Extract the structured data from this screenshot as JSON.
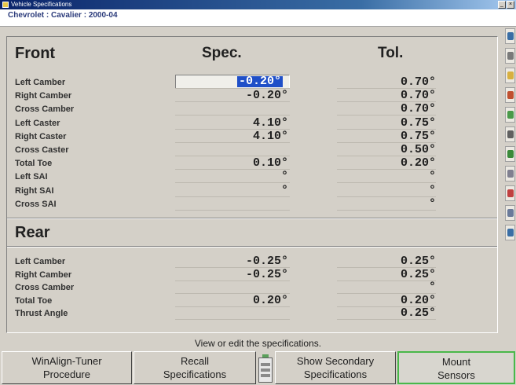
{
  "window": {
    "title": "Vehicle Specifications"
  },
  "vehicle": "Chevrolet : Cavalier : 2000-04",
  "headers": {
    "front": "Front",
    "spec": "Spec.",
    "tol": "Tol.",
    "rear": "Rear"
  },
  "front_rows": [
    {
      "label": "Left Camber",
      "spec": "-0.20°",
      "tol": "0.70°"
    },
    {
      "label": "Right Camber",
      "spec": "-0.20°",
      "tol": "0.70°"
    },
    {
      "label": "Cross Camber",
      "spec": "",
      "tol": "0.70°"
    },
    {
      "label": "Left Caster",
      "spec": "4.10°",
      "tol": "0.75°"
    },
    {
      "label": "Right Caster",
      "spec": "4.10°",
      "tol": "0.75°"
    },
    {
      "label": "Cross Caster",
      "spec": "",
      "tol": "0.50°"
    },
    {
      "label": "Total Toe",
      "spec": "0.10°",
      "tol": "0.20°"
    },
    {
      "label": "Left SAI",
      "spec": "°",
      "tol": "°"
    },
    {
      "label": "Right SAI",
      "spec": "°",
      "tol": "°"
    },
    {
      "label": "Cross SAI",
      "spec": "",
      "tol": "°"
    }
  ],
  "selected_spec": "-0.20",
  "selected_spec_unit": "°",
  "rear_rows": [
    {
      "label": "Left Camber",
      "spec": "-0.25°",
      "tol": "0.25°"
    },
    {
      "label": "Right Camber",
      "spec": "-0.25°",
      "tol": "0.25°"
    },
    {
      "label": "Cross Camber",
      "spec": "",
      "tol": "°"
    },
    {
      "label": "Total Toe",
      "spec": "0.20°",
      "tol": "0.20°"
    },
    {
      "label": "Thrust Angle",
      "spec": "",
      "tol": "0.25°"
    }
  ],
  "status": "View or edit the specifications.",
  "buttons": [
    {
      "line1": "WinAlign-Tuner",
      "line2": "Procedure"
    },
    {
      "line1": "Recall",
      "line2": "Specifications"
    },
    {
      "line1": "Show Secondary",
      "line2": "Specifications"
    },
    {
      "line1": "Mount",
      "line2": "Sensors"
    }
  ],
  "side_icons": [
    "specifications-icon",
    "vehicle-icon",
    "meter-icon",
    "wrench-icon",
    "sensor-icon",
    "tire-icon",
    "gauge-icon",
    "printer-icon",
    "chart-icon",
    "search-icon",
    "help-icon"
  ],
  "colors": {
    "selection": "#1f4fc8",
    "highlight_border": "#4ab84a"
  }
}
